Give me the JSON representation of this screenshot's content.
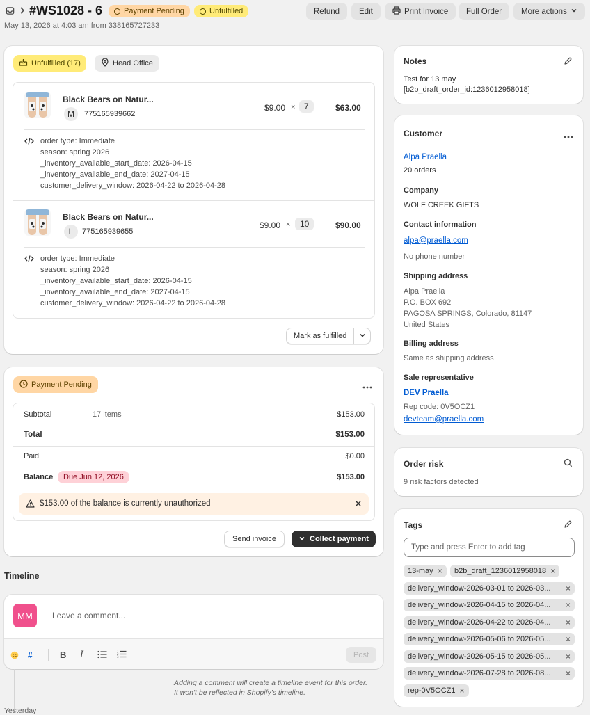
{
  "header": {
    "order_id": "#WS1028 - 6",
    "payment_badge": "Payment Pending",
    "fulfillment_badge": "Unfulfilled",
    "subtitle": "May 13, 2026 at 4:03 am from 338165727233",
    "buttons": {
      "refund": "Refund",
      "edit": "Edit",
      "print": "Print Invoice",
      "full_order": "Full Order",
      "more": "More actions"
    }
  },
  "fulfillment": {
    "status": "Unfulfilled (17)",
    "location": "Head Office",
    "items": [
      {
        "title": "Black Bears on Natur...",
        "variant": "M",
        "sku": "775165939662",
        "price": "$9.00",
        "times": "×",
        "qty": "7",
        "total": "$63.00",
        "props": [
          "order type: Immediate",
          "season: spring 2026",
          "_inventory_available_start_date: 2026-04-15",
          "_inventory_available_end_date: 2027-04-15",
          "customer_delivery_window: 2026-04-22 to 2026-04-28"
        ]
      },
      {
        "title": "Black Bears on Natur...",
        "variant": "L",
        "sku": "775165939655",
        "price": "$9.00",
        "times": "×",
        "qty": "10",
        "total": "$90.00",
        "props": [
          "order type: Immediate",
          "season: spring 2026",
          "_inventory_available_start_date: 2026-04-15",
          "_inventory_available_end_date: 2027-04-15",
          "customer_delivery_window: 2026-04-22 to 2026-04-28"
        ]
      }
    ],
    "mark_fulfilled": "Mark as fulfilled"
  },
  "payment": {
    "status": "Payment Pending",
    "subtotal_label": "Subtotal",
    "subtotal_items": "17 items",
    "subtotal": "$153.00",
    "total_label": "Total",
    "total": "$153.00",
    "paid_label": "Paid",
    "paid": "$0.00",
    "balance_label": "Balance",
    "due_badge": "Due Jun 12, 2026",
    "balance": "$153.00",
    "warning": "$153.00 of the balance is currently unauthorized",
    "send_invoice": "Send invoice",
    "collect_payment": "Collect payment"
  },
  "timeline": {
    "title": "Timeline",
    "avatar": "MM",
    "placeholder": "Leave a comment...",
    "hash": "#",
    "bold": "B",
    "italic": "I",
    "post": "Post",
    "note_line1": "Adding a comment will create a timeline event for this order.",
    "note_line2": "It won't be reflected in Shopify's timeline.",
    "yesterday": "Yesterday"
  },
  "notes": {
    "title": "Notes",
    "line1": "Test for 13 may",
    "line2": "[b2b_draft_order_id:1236012958018]"
  },
  "customer": {
    "title": "Customer",
    "name": "Alpa Praella",
    "orders": "20 orders",
    "company_label": "Company",
    "company": "WOLF CREEK GIFTS",
    "contact_label": "Contact information",
    "email": "alpa@praella.com",
    "phone": "No phone number",
    "shipping_label": "Shipping address",
    "ship_lines": [
      "Alpa Praella",
      "P.O. BOX 692",
      "PAGOSA SPRINGS, Colorado, 81147",
      "United States"
    ],
    "billing_label": "Billing address",
    "billing": "Same as shipping address",
    "rep_label": "Sale representative",
    "rep_name": "DEV Praella",
    "rep_code": "Rep code: 0V5OCZ1",
    "rep_email": "devteam@praella.com"
  },
  "risk": {
    "title": "Order risk",
    "text": "9 risk factors detected"
  },
  "tags": {
    "title": "Tags",
    "placeholder": "Type and press Enter to add tag",
    "items": [
      "13-may",
      "b2b_draft_1236012958018",
      "delivery_window-2026-03-01 to 2026-03...",
      "delivery_window-2026-04-15 to 2026-04...",
      "delivery_window-2026-04-22 to 2026-04...",
      "delivery_window-2026-05-06 to 2026-05...",
      "delivery_window-2026-05-15 to 2026-05...",
      "delivery_window-2026-07-28 to 2026-08...",
      "rep-0V5OCZ1"
    ]
  },
  "colors": {
    "accent_link": "#005bd3",
    "badge_orange": "#ffd6a4",
    "badge_yellow": "#ffeb78",
    "due_badge": "#fed1d7",
    "warning_bg": "#fff1e3",
    "avatar": "#f0508c"
  }
}
